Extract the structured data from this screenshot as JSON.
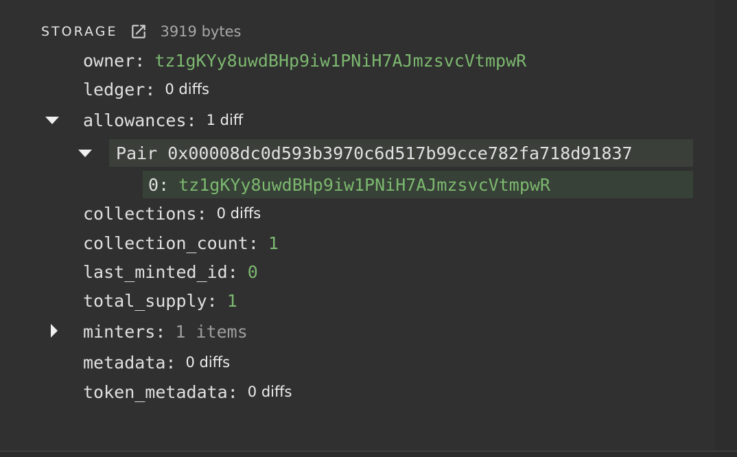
{
  "header": {
    "title": "STORAGE",
    "size": "3919 bytes",
    "open_icon": "open-in-new-icon"
  },
  "rows": {
    "owner": {
      "key": "owner",
      "value": "tz1gKYy8uwdBHp9iw1PNiH7AJmzsvcVtmpwR"
    },
    "ledger": {
      "key": "ledger",
      "value": "0 diffs"
    },
    "allowances": {
      "key": "allowances",
      "value": "1 diff",
      "expanded": true,
      "pair": {
        "key": "Pair 0x00008dc0d593b3970c6d517b99cce782fa718d91837",
        "expanded": true,
        "child": {
          "key": "0",
          "value": "tz1gKYy8uwdBHp9iw1PNiH7AJmzsvcVtmpwR"
        }
      }
    },
    "collections": {
      "key": "collections",
      "value": "0 diffs"
    },
    "collection_count": {
      "key": "collection_count",
      "value": "1"
    },
    "last_minted_id": {
      "key": "last_minted_id",
      "value": "0"
    },
    "total_supply": {
      "key": "total_supply",
      "value": "1"
    },
    "minters": {
      "key": "minters",
      "value": "1 items",
      "expanded": false
    },
    "metadata": {
      "key": "metadata",
      "value": "0 diffs"
    },
    "token_metadata": {
      "key": "token_metadata",
      "value": "0 diffs"
    }
  },
  "colors": {
    "background": "#303030",
    "text": "#e0e0e0",
    "value_green": "#7cb86f",
    "highlight": "#3a3f3a"
  }
}
